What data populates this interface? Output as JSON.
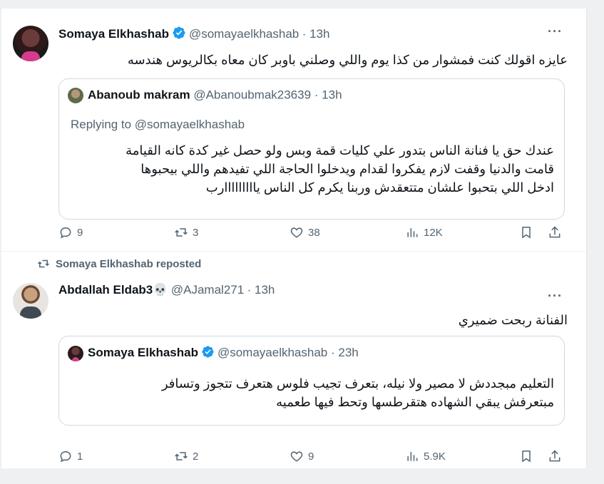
{
  "tweets": [
    {
      "author": "Somaya Elkhashab",
      "handle": "@somayaelkhashab",
      "time": "· 13h",
      "text": "عايزه اقولك كنت فمشوار من كذا يوم واللي وصلني باوبر كان معاه بكالريوس هندسه",
      "quote": {
        "author": "Abanoub makram",
        "handle": "@Abanoubmak23639",
        "time": "· 13h",
        "replying": "Replying to @somayaelkhashab",
        "lines": [
          "عندك حق يا فنانة الناس بتدور علي كليات قمة وبس ولو حصل غير كدة كانه القيامة",
          "قامت والدنيا وقفت لازم يفكروا لقدام ويدخلوا الحاجة اللي تفيدهم واللي بيحبوها",
          "ادخل اللي بتحبوا علشان متتعقدش وربنا يكرم كل الناس يااااااااارب"
        ]
      },
      "actions": {
        "replies": "9",
        "reposts": "3",
        "likes": "38",
        "views": "12K"
      }
    },
    {
      "repost_label": "Somaya Elkhashab reposted",
      "author": "Abdallah Eldab3💀",
      "handle": "@AJamal271",
      "time": "· 13h",
      "text": "الفنانة ربحت ضميري",
      "quote": {
        "author": "Somaya Elkhashab",
        "handle": "@somayaelkhashab",
        "time": "· 23h",
        "lines": [
          "التعليم مبجددش لا مصير ولا نيله، بتعرف تجيب فلوس هتعرف تتجوز وتسافر",
          "مبتعرفش يبقي الشهاده هتقرطسها وتحط فيها طعميه"
        ]
      },
      "actions": {
        "replies": "1",
        "reposts": "2",
        "likes": "9",
        "views": "5.9K"
      }
    }
  ],
  "more_label": "···",
  "colors": {
    "verified": "#1d9bf0",
    "muted": "#536471",
    "border": "#cfd9de"
  },
  "icons": [
    "verified-badge-icon",
    "reply-icon",
    "repost-icon",
    "like-icon",
    "views-icon",
    "bookmark-icon",
    "share-icon",
    "more-icon"
  ]
}
